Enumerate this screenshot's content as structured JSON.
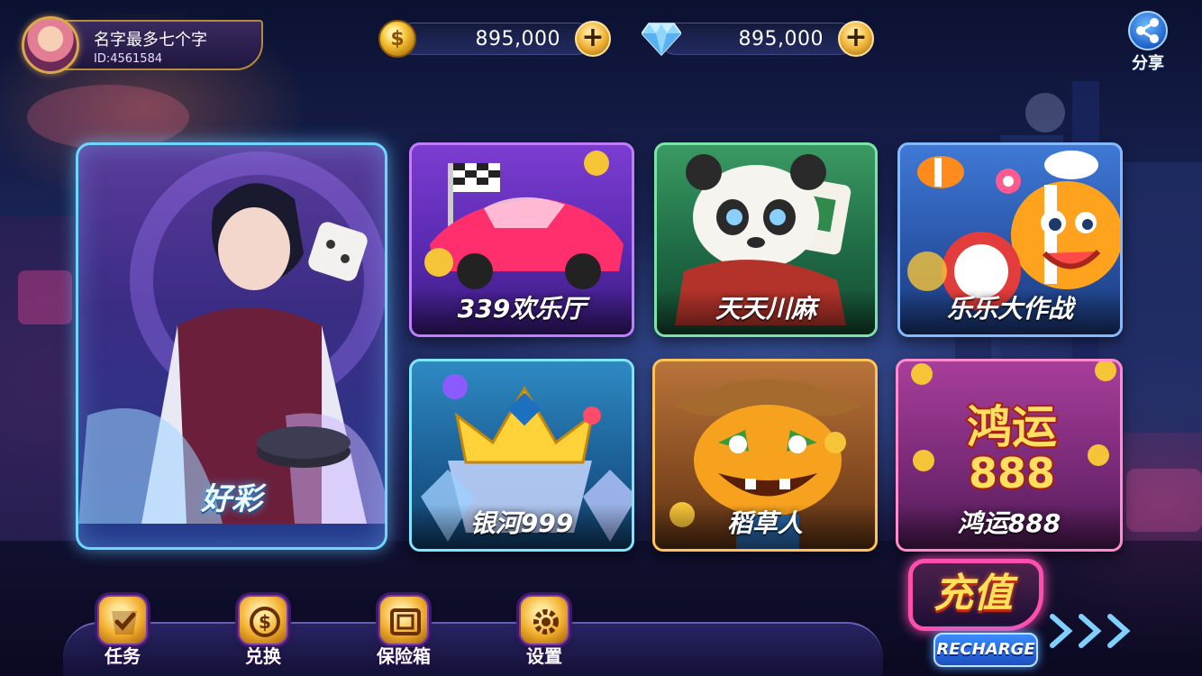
{
  "user": {
    "nickname": "名字最多七个字",
    "id_text": "ID:4561584"
  },
  "currencies": {
    "gold": {
      "value": "895,000",
      "icon": "gold-coin-icon"
    },
    "diamond": {
      "value": "895,000",
      "icon": "diamond-icon"
    }
  },
  "share": {
    "label": "分享",
    "icon": "share-icon"
  },
  "games": {
    "featured": {
      "label": "好彩"
    },
    "items": [
      {
        "label": "339欢乐厅"
      },
      {
        "label": "天天川麻"
      },
      {
        "label": "乐乐大作战"
      },
      {
        "label": "银河999"
      },
      {
        "label": "稻草人"
      },
      {
        "label": "鸿运888",
        "art_text": "鸿运\n888"
      }
    ]
  },
  "nav": [
    {
      "label": "任务",
      "icon": "task-icon"
    },
    {
      "label": "兑换",
      "icon": "exchange-icon"
    },
    {
      "label": "保险箱",
      "icon": "safe-icon"
    },
    {
      "label": "设置",
      "icon": "settings-gear-icon"
    }
  ],
  "recharge": {
    "label_cn": "充值",
    "label_en": "RECHARGE"
  },
  "colors": {
    "gold_accent": "#f1b539",
    "neon_pink": "#ff4fae",
    "neon_blue": "#6fd7ff"
  }
}
